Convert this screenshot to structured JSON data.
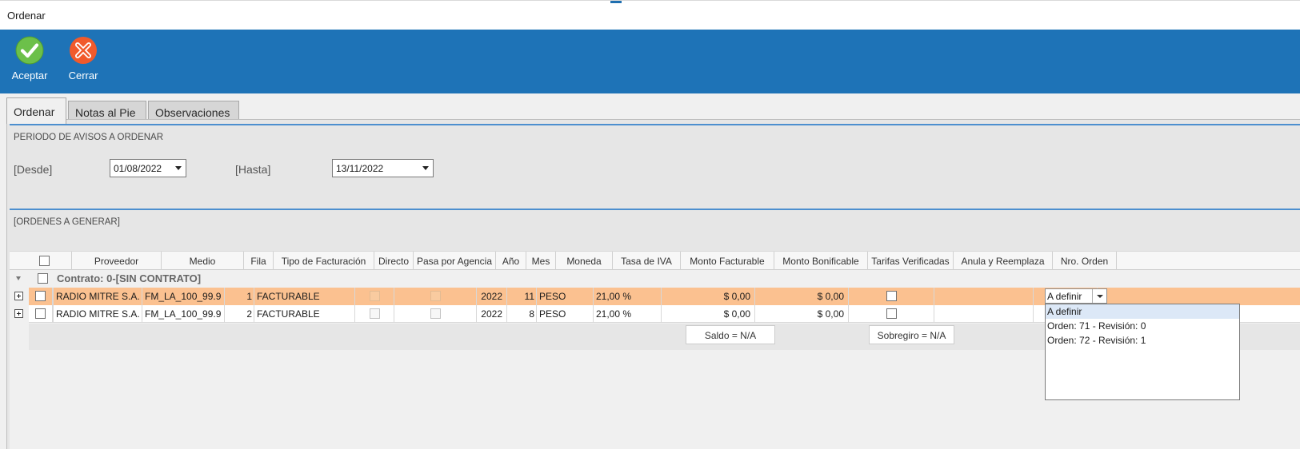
{
  "window": {
    "title": "Ordenar"
  },
  "ribbon": {
    "accept_label": "Aceptar",
    "close_label": "Cerrar",
    "accept_icon": "check-circle-icon",
    "close_icon": "close-circle-icon"
  },
  "tabs": [
    {
      "label": "Ordenar"
    },
    {
      "label": "Notas al Pie"
    },
    {
      "label": "Observaciones"
    }
  ],
  "periodo": {
    "title": "PERIODO DE AVISOS A ORDENAR",
    "desde_label": "[Desde]",
    "desde_value": "01/08/2022",
    "hasta_label": "[Hasta]",
    "hasta_value": "13/11/2022"
  },
  "ordenes": {
    "title": "[ORDENES A GENERAR]",
    "columns": [
      "Proveedor",
      "Medio",
      "Fila",
      "Tipo de Facturación",
      "Directo",
      "Pasa por Agencia",
      "Año",
      "Mes",
      "Moneda",
      "Tasa de IVA",
      "Monto Facturable",
      "Monto Bonificable",
      "Tarifas Verificadas",
      "Anula y Reemplaza",
      "Nro. Orden"
    ],
    "group_label": "Contrato: 0-[SIN CONTRATO]",
    "rows": [
      {
        "proveedor": "RADIO MITRE S.A.",
        "medio": "FM_LA_100_99.9",
        "fila": "1",
        "tipo": "FACTURABLE",
        "anio": "2022",
        "mes": "11",
        "moneda": "PESO",
        "iva": "21,00 %",
        "facturable": "$ 0,00",
        "bonificable": "$ 0,00",
        "nro_orden": "A definir"
      },
      {
        "proveedor": "RADIO MITRE S.A.",
        "medio": "FM_LA_100_99.9",
        "fila": "2",
        "tipo": "FACTURABLE",
        "anio": "2022",
        "mes": "8",
        "moneda": "PESO",
        "iva": "21,00 %",
        "facturable": "$ 0,00",
        "bonificable": "$ 0,00",
        "nro_orden": ""
      }
    ],
    "footer": {
      "saldo": "Saldo = N/A",
      "sobregiro": "Sobregiro = N/A"
    },
    "dropdown_options": [
      "A definir",
      "Orden: 71 - Revisión: 0",
      "Orden: 72 - Revisión: 1"
    ]
  },
  "colors": {
    "ribbon": "#1e73b7",
    "selected_row": "#fbc190",
    "group_rule": "#4d8fcf",
    "accept": "#6cc04a",
    "close": "#f15a2b"
  }
}
